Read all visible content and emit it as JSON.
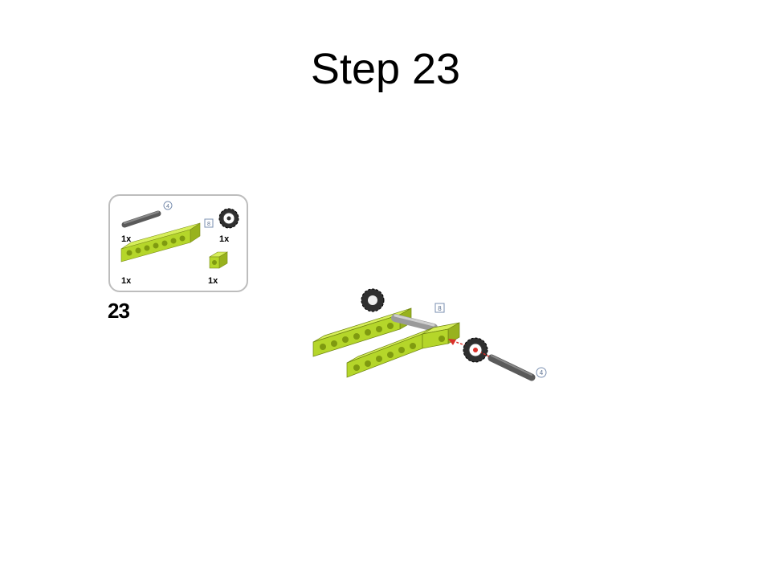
{
  "slide": {
    "title": "Step 23"
  },
  "parts_list": {
    "items": [
      {
        "name": "axle",
        "quantity": "1x",
        "length_label": "4"
      },
      {
        "name": "gear",
        "quantity": "1x"
      },
      {
        "name": "technic-beam-long",
        "quantity": "1x",
        "length_label": "8"
      },
      {
        "name": "technic-brick-1x2",
        "quantity": "1x"
      }
    ]
  },
  "step": {
    "number": "23"
  },
  "assembly": {
    "beam_length_label": "8",
    "axle_length_label": "4"
  },
  "colors": {
    "lime": "#b5d62a",
    "axle_gray": "#6b6b6b",
    "arrow_red": "#d9302a",
    "callout_blue": "#7a8fb0"
  }
}
